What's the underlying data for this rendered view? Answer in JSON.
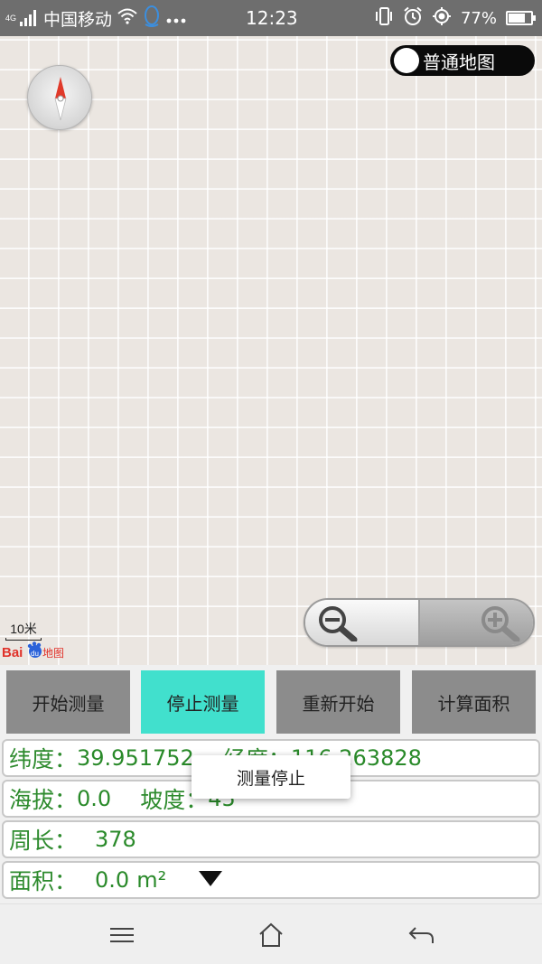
{
  "status_bar": {
    "network_type": "4G",
    "carrier": "中国移动",
    "time": "12:23",
    "battery_percent": "77%",
    "battery_level": 0.77,
    "icons": [
      "signal-icon",
      "wifi-icon",
      "qq-icon",
      "more-icon",
      "vibrate-icon",
      "alarm-icon",
      "location-icon",
      "battery-icon"
    ]
  },
  "map": {
    "type_toggle_label": "普通地图",
    "scale_label": "10米",
    "logo_text": "Baidu地图"
  },
  "actions": {
    "start": "开始测量",
    "stop": "停止测量",
    "restart": "重新开始",
    "calc_area": "计算面积",
    "active_color": "#41e0cd"
  },
  "info": {
    "lat_label": "纬度：",
    "lat_value": "39.951752",
    "lng_label": "经度：",
    "lng_value": "116.263828",
    "alt_label": "海拔：",
    "alt_value": "0.0",
    "slope_label": "坡度：",
    "slope_value": "45",
    "perimeter_label": "周长：",
    "perimeter_value": "378",
    "area_label": "面积：",
    "area_value": "0.0",
    "area_unit": "m²"
  },
  "toast": "测量停止",
  "navbar": {
    "icons": [
      "menu-icon",
      "home-icon",
      "back-icon"
    ]
  }
}
